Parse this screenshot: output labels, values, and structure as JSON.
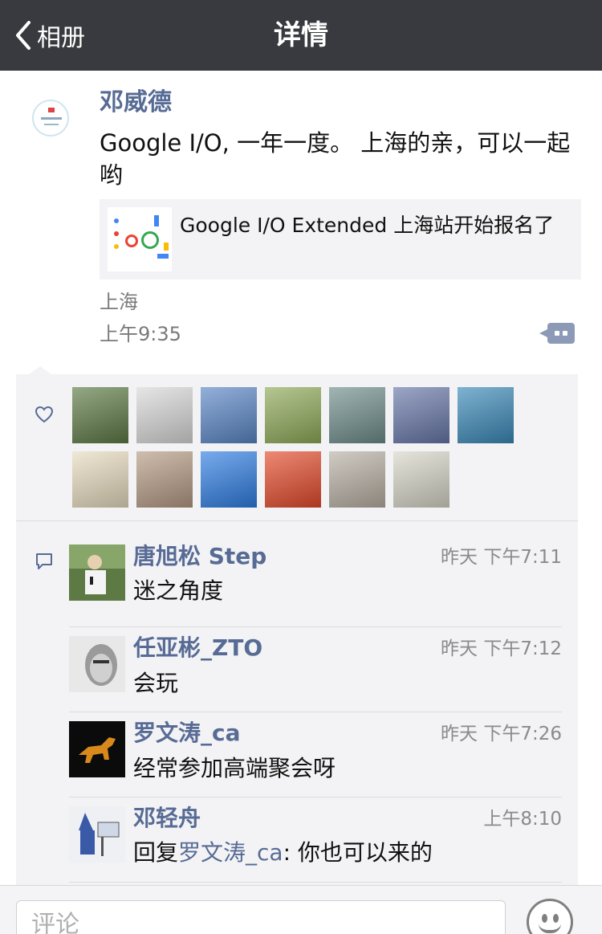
{
  "nav": {
    "back_label": "相册",
    "title": "详情"
  },
  "post": {
    "author": "邓威德",
    "text": "Google I/O, 一年一度。 上海的亲，可以一起哟",
    "link": {
      "title": "Google I/O Extended 上海站开始报名了"
    },
    "location": "上海",
    "time": "上午9:35"
  },
  "likes": [
    {
      "name": "avatar-landscape-man",
      "color": "#5d7a45"
    },
    {
      "name": "avatar-white-hair",
      "color": "#d9d9d9"
    },
    {
      "name": "avatar-sky-building",
      "color": "#5a86c6"
    },
    {
      "name": "avatar-silhouette-green",
      "color": "#8faa58"
    },
    {
      "name": "avatar-horse-sky",
      "color": "#6f8d8c"
    },
    {
      "name": "avatar-mountains-mist",
      "color": "#6777a8"
    },
    {
      "name": "avatar-blue-sparkle",
      "color": "#3a89b8"
    },
    {
      "name": "avatar-calligraphy",
      "color": "#e8dcc0"
    },
    {
      "name": "avatar-girl-guitar",
      "color": "#b59a84"
    },
    {
      "name": "avatar-cartoon-girl",
      "color": "#2f7ee3"
    },
    {
      "name": "avatar-red-chinese-boy",
      "color": "#e44a2a"
    },
    {
      "name": "avatar-woman-portrait",
      "color": "#b8b0a4"
    },
    {
      "name": "avatar-woman-flowers",
      "color": "#d8d6c8"
    }
  ],
  "comments": [
    {
      "name": "唐旭松 Step",
      "time": "昨天 下午7:11",
      "text": "迷之角度",
      "avatar_color": "#5d7a45"
    },
    {
      "name": "任亚彬_ZTO",
      "time": "昨天 下午7:12",
      "text": "会玩",
      "avatar_color": "#bdbdbd"
    },
    {
      "name": "罗文涛_ca",
      "time": "昨天 下午7:26",
      "text": "经常参加高端聚会呀",
      "avatar_color": "#0b0b0b"
    },
    {
      "name": "邓轻舟",
      "time": "上午8:10",
      "reply_prefix": "回复",
      "reply_to": "罗文涛_ca",
      "reply_text": ": 你也可以来的",
      "avatar_color": "#e6e9f0"
    }
  ],
  "input": {
    "placeholder": "评论"
  }
}
